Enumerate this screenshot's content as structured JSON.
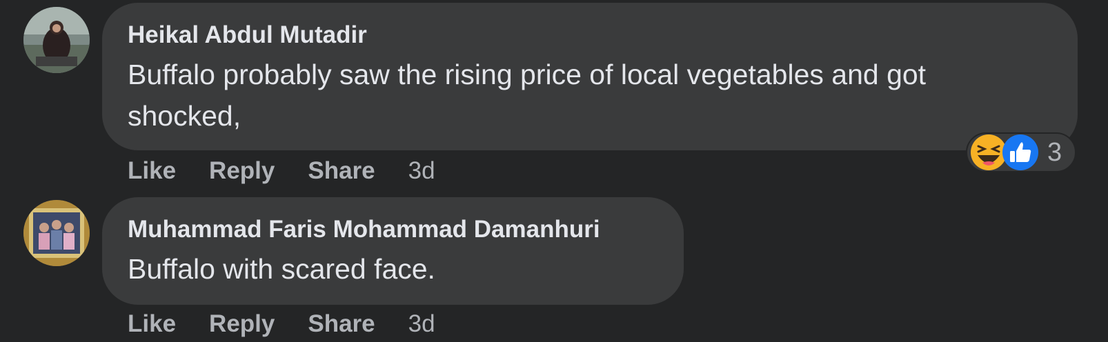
{
  "colors": {
    "background": "#242526",
    "bubble": "#3a3b3c",
    "primary_text": "#e4e6eb",
    "secondary_text": "#b0b3b8",
    "like_blue": "#1877f2",
    "haha_yellow": "#f7b125"
  },
  "comments": [
    {
      "author": "Heikal Abdul Mutadir",
      "text_line1": "Buffalo probably saw the rising price of local vegetables and got",
      "text_line2": "shocked,",
      "actions": {
        "like": "Like",
        "reply": "Reply",
        "share": "Share"
      },
      "time": "3d",
      "reactions": {
        "icons": [
          "haha-icon",
          "like-icon"
        ],
        "count": "3"
      }
    },
    {
      "author": "Muhammad Faris Mohammad Damanhuri",
      "text_line1": "Buffalo with scared face.",
      "actions": {
        "like": "Like",
        "reply": "Reply",
        "share": "Share"
      },
      "time": "3d"
    }
  ]
}
